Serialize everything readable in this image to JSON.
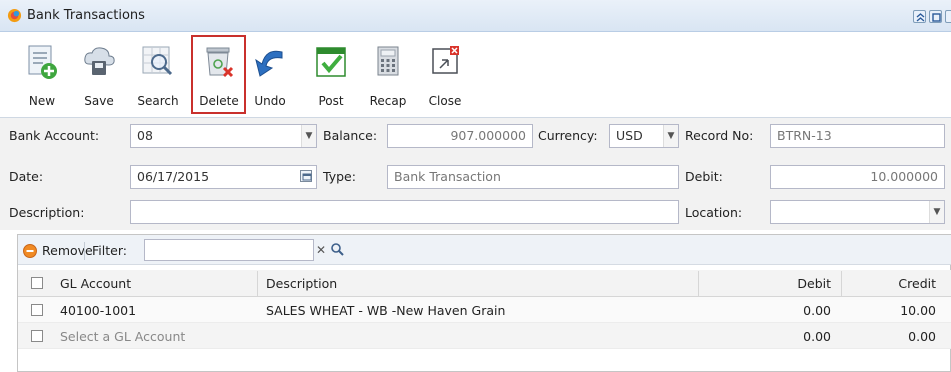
{
  "window": {
    "title": "Bank Transactions"
  },
  "toolbar": {
    "new": "New",
    "save": "Save",
    "search": "Search",
    "delete": "Delete",
    "undo": "Undo",
    "post": "Post",
    "recap": "Recap",
    "close": "Close"
  },
  "form": {
    "bank_account_label": "Bank Account:",
    "bank_account_value": "08",
    "balance_label": "Balance:",
    "balance_value": "907.000000",
    "currency_label": "Currency:",
    "currency_value": "USD",
    "record_no_label": "Record No:",
    "record_no_value": "BTRN-13",
    "date_label": "Date:",
    "date_value": "06/17/2015",
    "type_label": "Type:",
    "type_value": "Bank Transaction",
    "debit_label": "Debit:",
    "debit_value": "10.000000",
    "description_label": "Description:",
    "description_value": "",
    "location_label": "Location:",
    "location_value": ""
  },
  "grid": {
    "remove_label": "Remove",
    "filter_label": "Filter:",
    "filter_value": "",
    "columns": {
      "gl_account": "GL Account",
      "description": "Description",
      "debit": "Debit",
      "credit": "Credit"
    },
    "rows": [
      {
        "gl_account": "40100-1001",
        "description": "SALES WHEAT - WB -New Haven Grain",
        "debit": "0.00",
        "credit": "10.00"
      },
      {
        "gl_account": "Select a GL Account",
        "description": "",
        "debit": "0.00",
        "credit": "0.00"
      }
    ]
  },
  "colors": {
    "accent": "#c9302c",
    "titlebar": "#dce7f4"
  }
}
